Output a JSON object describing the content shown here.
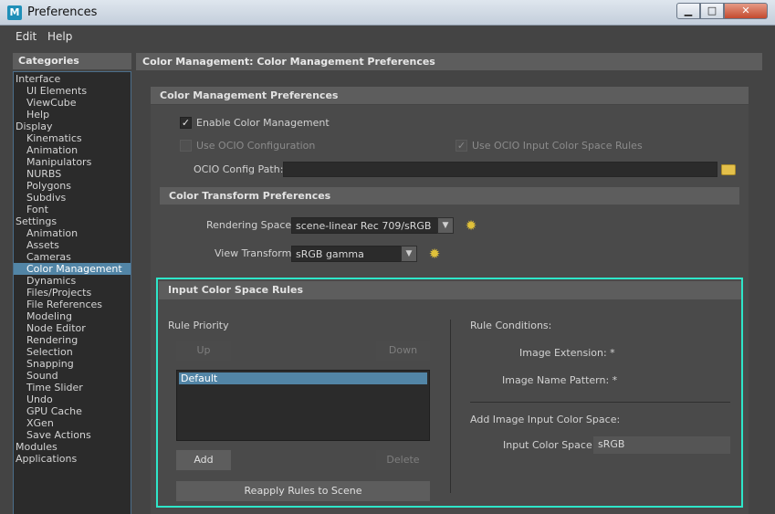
{
  "window": {
    "app_icon": "M",
    "title": "Preferences",
    "minimize_glyph": "▁",
    "maximize_glyph": "□",
    "close_glyph": "✕"
  },
  "menu": {
    "items": [
      "Edit",
      "Help"
    ]
  },
  "categories": {
    "header": "Categories",
    "items": [
      {
        "label": "Interface",
        "level": 0
      },
      {
        "label": "UI Elements",
        "level": 1
      },
      {
        "label": "ViewCube",
        "level": 1
      },
      {
        "label": "Help",
        "level": 1
      },
      {
        "label": "Display",
        "level": 0
      },
      {
        "label": "Kinematics",
        "level": 1
      },
      {
        "label": "Animation",
        "level": 1
      },
      {
        "label": "Manipulators",
        "level": 1
      },
      {
        "label": "NURBS",
        "level": 1
      },
      {
        "label": "Polygons",
        "level": 1
      },
      {
        "label": "Subdivs",
        "level": 1
      },
      {
        "label": "Font",
        "level": 1
      },
      {
        "label": "Settings",
        "level": 0
      },
      {
        "label": "Animation",
        "level": 1
      },
      {
        "label": "Assets",
        "level": 1
      },
      {
        "label": "Cameras",
        "level": 1
      },
      {
        "label": "Color Management",
        "level": 1,
        "selected": true
      },
      {
        "label": "Dynamics",
        "level": 1
      },
      {
        "label": "Files/Projects",
        "level": 1
      },
      {
        "label": "File References",
        "level": 1
      },
      {
        "label": "Modeling",
        "level": 1
      },
      {
        "label": "Node Editor",
        "level": 1
      },
      {
        "label": "Rendering",
        "level": 1
      },
      {
        "label": "Selection",
        "level": 1
      },
      {
        "label": "Snapping",
        "level": 1
      },
      {
        "label": "Sound",
        "level": 1
      },
      {
        "label": "Time Slider",
        "level": 1
      },
      {
        "label": "Undo",
        "level": 1
      },
      {
        "label": "GPU Cache",
        "level": 1
      },
      {
        "label": "XGen",
        "level": 1
      },
      {
        "label": "Save Actions",
        "level": 1
      },
      {
        "label": "Modules",
        "level": 0
      },
      {
        "label": "Applications",
        "level": 0
      }
    ]
  },
  "main": {
    "header": "Color Management: Color Management Preferences",
    "cm_prefs": {
      "title": "Color Management Preferences",
      "enable_cm": {
        "label": "Enable Color Management",
        "checked": true
      },
      "use_ocio_config": {
        "label": "Use OCIO Configuration",
        "checked": false
      },
      "use_ocio_input_rules": {
        "label": "Use OCIO Input Color Space Rules",
        "checked": true
      },
      "ocio_config_path": {
        "label": "OCIO Config Path:",
        "value": ""
      }
    },
    "color_transform": {
      "title": "Color Transform Preferences",
      "rendering_space": {
        "label": "Rendering Space:",
        "value": "scene-linear Rec 709/sRGB"
      },
      "view_transform": {
        "label": "View Transform:",
        "value": "sRGB gamma"
      }
    },
    "input_rules": {
      "title": "Input Color Space Rules",
      "rule_priority_label": "Rule Priority",
      "up_label": "Up",
      "down_label": "Down",
      "rules": [
        "Default"
      ],
      "add_label": "Add",
      "delete_label": "Delete",
      "reapply_label": "Reapply Rules to Scene",
      "rule_conditions_label": "Rule Conditions:",
      "image_extension_label": "Image Extension: *",
      "image_name_pattern_label": "Image Name Pattern: *",
      "add_input_cs_label": "Add Image Input Color Space:",
      "input_color_space": {
        "label": "Input Color Space:",
        "value": "sRGB"
      }
    }
  },
  "glyphs": {
    "check": "✓",
    "arrow_down": "▼",
    "gear": "✹"
  }
}
